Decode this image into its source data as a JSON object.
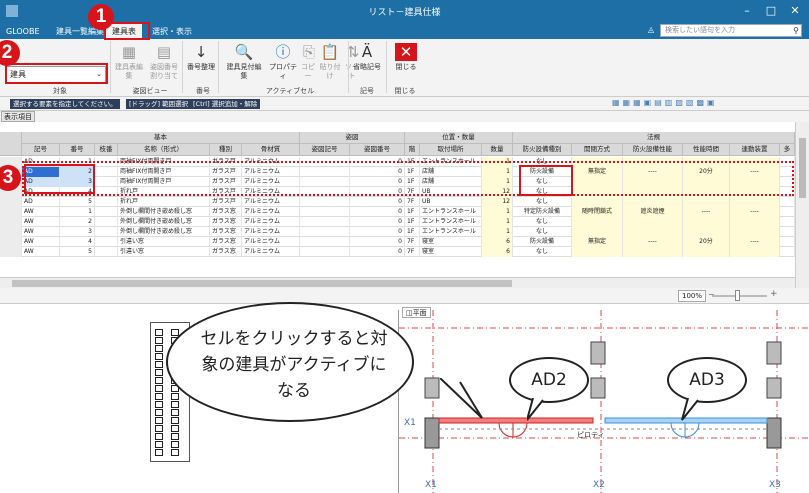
{
  "window": {
    "title": "リスト－建具仕様"
  },
  "tabs": [
    {
      "label": "GLOOBE",
      "active": false
    },
    {
      "label": "建具一覧編集",
      "active": false
    },
    {
      "label": "建具表",
      "active": true
    },
    {
      "label": "選択・表示",
      "active": false
    }
  ],
  "search": {
    "placeholder": "検索したい語句を入力"
  },
  "ribbon": {
    "combo_value": "建具",
    "buttons": [
      {
        "label": "建具表編集",
        "icon": "table-edit-icon",
        "glyph": "▦",
        "dim": true
      },
      {
        "label": "姿図番号\n割り当て",
        "icon": "assign-number-icon",
        "glyph": "▤",
        "dim": true
      },
      {
        "label": "番号整理",
        "icon": "sort-number-icon",
        "glyph": "↓",
        "dim": false
      },
      {
        "label": "建具見付編集",
        "icon": "preview-icon",
        "glyph": "🔍",
        "dim": false
      },
      {
        "label": "プロパティ",
        "icon": "info-icon",
        "glyph": "ⓘ",
        "dim": false
      },
      {
        "label": "コピー",
        "icon": "copy-icon",
        "glyph": "⎘",
        "dim": true
      },
      {
        "label": "貼り付け",
        "icon": "paste-icon",
        "glyph": "📋",
        "dim": true
      },
      {
        "label": "ソート",
        "icon": "sort-icon",
        "glyph": "⇅",
        "dim": true
      },
      {
        "label": "省略記号",
        "icon": "abbreviation-icon",
        "glyph": "Ä",
        "dim": false
      },
      {
        "label": "閉じる",
        "icon": "close-icon",
        "glyph": "✕",
        "dim": false
      }
    ],
    "groups": [
      "対象",
      "姿図ビュー",
      "番号",
      "アクティブセル",
      "記号",
      "閉じる"
    ]
  },
  "hints": [
    "選択する要素を指定してください。",
    "[ドラッグ] 範囲選択",
    "[Ctrl] 選択追加・解除"
  ],
  "display_button": "表示項目",
  "grid": {
    "groups": [
      "基本",
      "姿図",
      "位置・数量",
      "法規"
    ],
    "columns": [
      "記号",
      "番号",
      "枝番",
      "名称（形式）",
      "種別",
      "骨材質",
      "姿図記号",
      "姿図番号",
      "階",
      "取付場所",
      "数量",
      "防火設備種別",
      "開閉方式",
      "防火設備性能",
      "性能時間",
      "連動装置",
      "多"
    ],
    "rows": [
      {
        "sym": "AD",
        "no": "1",
        "name": "両袖FIX付両開き戸",
        "kind": "ガラス戸",
        "mat": "アルミニウム",
        "fig": "0",
        "floor": "1F",
        "place": "エントランスホール",
        "qty": "1",
        "fire": "なし",
        "open": "",
        "perf": "",
        "time": "",
        "link": ""
      },
      {
        "sym": "AD",
        "no": "2",
        "name": "両袖FIX付両開き戸",
        "kind": "ガラス戸",
        "mat": "アルミニウム",
        "fig": "0",
        "floor": "1F",
        "place": "店舗",
        "qty": "1",
        "fire": "防火設備",
        "open": "無指定",
        "perf": "----",
        "time": "20分",
        "link": "----",
        "sel": true,
        "active": true
      },
      {
        "sym": "AD",
        "no": "3",
        "name": "両袖FIX付両開き戸",
        "kind": "ガラス戸",
        "mat": "アルミニウム",
        "fig": "0",
        "floor": "1F",
        "place": "店舗",
        "qty": "1",
        "fire": "なし",
        "open": "",
        "perf": "",
        "time": "",
        "link": "",
        "sel": true
      },
      {
        "sym": "AD",
        "no": "4",
        "name": "折れ戸",
        "kind": "ガラス戸",
        "mat": "アルミニウム",
        "fig": "0",
        "floor": "7F",
        "place": "UB",
        "qty": "12",
        "fire": "なし",
        "open": "",
        "perf": "",
        "time": "",
        "link": ""
      },
      {
        "sym": "AD",
        "no": "5",
        "name": "折れ戸",
        "kind": "ガラス戸",
        "mat": "アルミニウム",
        "fig": "0",
        "floor": "7F",
        "place": "UB",
        "qty": "12",
        "fire": "なし",
        "open": "",
        "perf": "",
        "time": "",
        "link": ""
      },
      {
        "sym": "AW",
        "no": "1",
        "name": "外倒し欄間付き嵌め殺し窓",
        "kind": "ガラス窓",
        "mat": "アルミニウム",
        "fig": "0",
        "floor": "1F",
        "place": "エントランスホール",
        "qty": "1",
        "fire": "特定防火設備",
        "open": "随時閉鎖式",
        "perf": "遮炎遮煙",
        "time": "----",
        "link": "----"
      },
      {
        "sym": "AW",
        "no": "2",
        "name": "外倒し欄間付き嵌め殺し窓",
        "kind": "ガラス窓",
        "mat": "アルミニウム",
        "fig": "0",
        "floor": "1F",
        "place": "エントランスホール",
        "qty": "1",
        "fire": "なし",
        "open": "",
        "perf": "",
        "time": "",
        "link": ""
      },
      {
        "sym": "AW",
        "no": "3",
        "name": "外倒し欄間付き嵌め殺し窓",
        "kind": "ガラス窓",
        "mat": "アルミニウム",
        "fig": "0",
        "floor": "1F",
        "place": "エントランスホール",
        "qty": "1",
        "fire": "なし",
        "open": "",
        "perf": "",
        "time": "",
        "link": ""
      },
      {
        "sym": "AW",
        "no": "4",
        "name": "引違い窓",
        "kind": "ガラス窓",
        "mat": "アルミニウム",
        "fig": "0",
        "floor": "7F",
        "place": "寝室",
        "qty": "6",
        "fire": "防火設備",
        "open": "無指定",
        "perf": "----",
        "time": "20分",
        "link": "----"
      },
      {
        "sym": "AW",
        "no": "5",
        "name": "引違い窓",
        "kind": "ガラス窓",
        "mat": "アルミニウム",
        "fig": "0",
        "floor": "7F",
        "place": "寝室",
        "qty": "6",
        "fire": "なし",
        "open": "",
        "perf": "",
        "time": "",
        "link": ""
      }
    ]
  },
  "zoom": {
    "value": "100%",
    "level": 0.45
  },
  "plan": {
    "tab_label": "平面",
    "grid_labels": [
      "X1",
      "X1",
      "X2",
      "X3"
    ],
    "room_label": "ピロティ"
  },
  "callout": {
    "text": "セルをクリックすると対象の建具がアクティブになる",
    "ad2": "AD2",
    "ad3": "AD3"
  },
  "steps": [
    "1",
    "2",
    "3"
  ],
  "colors": {
    "accent": "#1d6fa5",
    "marker": "#d7141a",
    "selected": "#2f6fd1"
  }
}
